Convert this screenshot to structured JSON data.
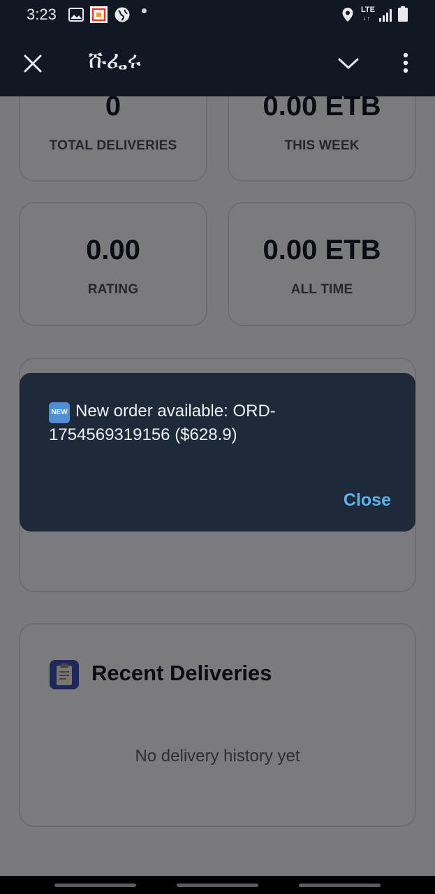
{
  "status_bar": {
    "time": "3:23",
    "network": "LTE",
    "network_arrows": "↓↑",
    "icons": [
      "image-icon",
      "app-notification-icon",
      "vpn-globe-icon",
      "location-icon",
      "signal-icon",
      "battery-icon"
    ]
  },
  "app_bar": {
    "title": "ሹፌሩ",
    "close_icon": "close-icon",
    "collapse_icon": "chevron-down-icon",
    "menu_icon": "more-vert-icon"
  },
  "stats": [
    {
      "value": "0",
      "label": "TOTAL DELIVERIES"
    },
    {
      "value": "0.00 ETB",
      "label": "THIS WEEK"
    },
    {
      "value": "0.00",
      "label": "RATING"
    },
    {
      "value": "0.00 ETB",
      "label": "ALL TIME"
    }
  ],
  "recent": {
    "icon": "clipboard-icon",
    "title": "Recent Deliveries",
    "empty_text": "No delivery history yet"
  },
  "dialog": {
    "badge": "NEW",
    "message": "New order available: ORD-1754569319156 ($628.9)",
    "close_label": "Close"
  },
  "colors": {
    "app_bar_bg": "#111823",
    "dialog_bg": "#1e293a",
    "accent": "#5cb3f0",
    "recent_icon_bg": "#3f51b5"
  }
}
